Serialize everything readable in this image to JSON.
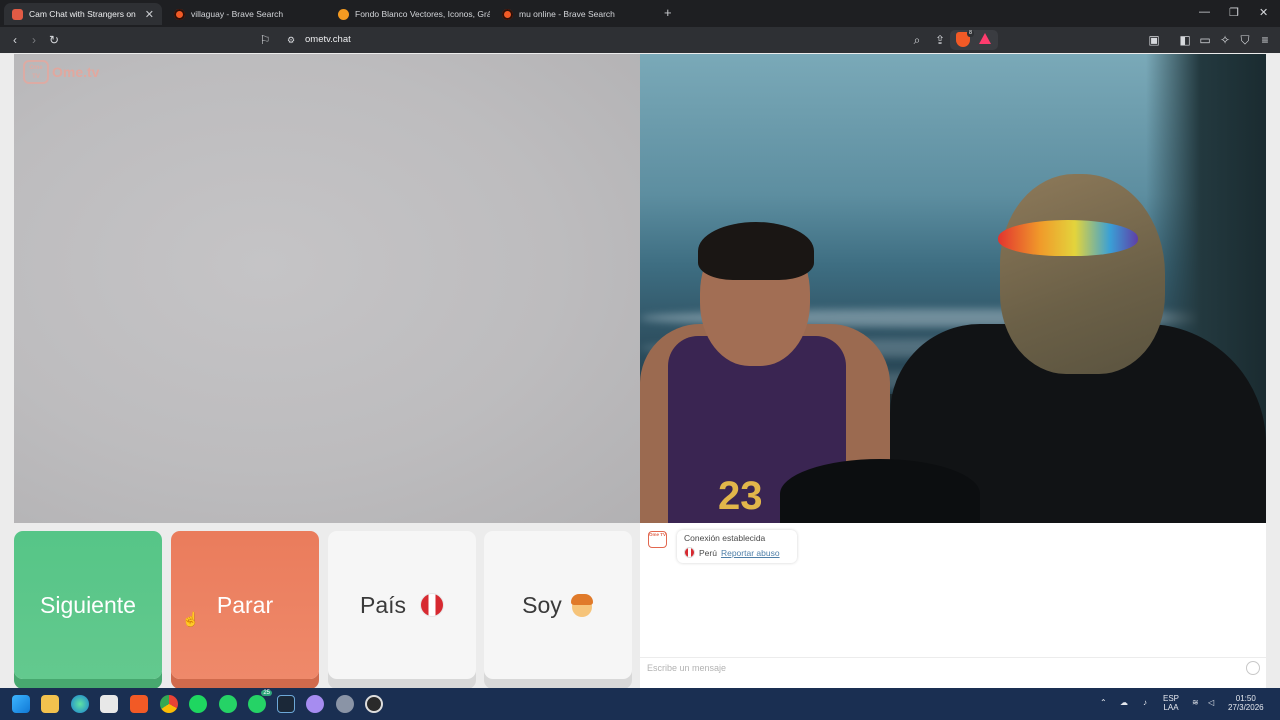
{
  "browser": {
    "tabs": [
      {
        "title": "Cam Chat with Strangers on",
        "active": true,
        "favicon": "ometv-icon"
      },
      {
        "title": "villaguay - Brave Search",
        "active": false,
        "favicon": "brave-icon"
      },
      {
        "title": "Fondo Blanco Vectores, Iconos, Gráfi",
        "active": false,
        "favicon": "freepik-icon"
      },
      {
        "title": "mu online - Brave Search",
        "active": false,
        "favicon": "brave-icon"
      }
    ],
    "url": "ometv.chat",
    "shield_badge": "8"
  },
  "page": {
    "logo": {
      "text": "Ome.tv",
      "icon_text": "Ome TV"
    },
    "buttons": {
      "next": "Siguiente",
      "stop": "Parar",
      "country": "País",
      "sex": "Soy"
    },
    "remote_video": {
      "jersey_number": "23"
    },
    "chat": {
      "status": "Conexión establecida",
      "country": "Perú",
      "report": "Reportar abuso",
      "placeholder": "Escribe un mensaje"
    }
  },
  "taskbar": {
    "language": "ESP",
    "layout": "LAA",
    "time": "01:50",
    "date": "27/3/2026",
    "whatsapp_badge": "25"
  },
  "colors": {
    "next": "#56c587",
    "stop": "#ea7c5c",
    "chrome": "#2e3034",
    "taskbar": "#1a2f52"
  }
}
